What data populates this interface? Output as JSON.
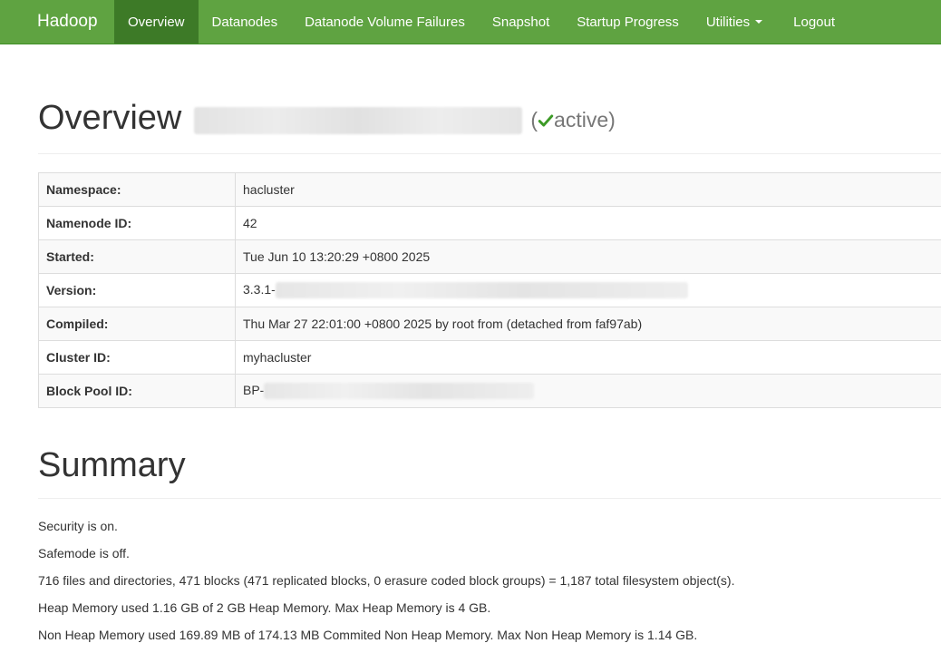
{
  "navbar": {
    "brand": "Hadoop",
    "items": [
      {
        "label": "Overview",
        "active": true
      },
      {
        "label": "Datanodes",
        "active": false
      },
      {
        "label": "Datanode Volume Failures",
        "active": false
      },
      {
        "label": "Snapshot",
        "active": false
      },
      {
        "label": "Startup Progress",
        "active": false
      },
      {
        "label": "Utilities",
        "active": false,
        "dropdown": true
      },
      {
        "label": "Logout",
        "active": false
      }
    ],
    "colors": {
      "background": "#5fa341",
      "active": "#3d7a27",
      "text": "#ffffff"
    }
  },
  "overview": {
    "title": "Overview",
    "status_open": "(",
    "status_icon": "check-icon",
    "status_text": "active)",
    "status_icon_color": "#3c9a26",
    "rows": [
      {
        "key": "Namespace:",
        "value": "hacluster"
      },
      {
        "key": "Namenode ID:",
        "value": "42"
      },
      {
        "key": "Started:",
        "value": "Tue Jun 10 13:20:29 +0800 2025"
      },
      {
        "key": "Version:",
        "value": "3.3.1-"
      },
      {
        "key": "Compiled:",
        "value": "Thu Mar 27 22:01:00 +0800 2025 by root from (detached from faf97ab)"
      },
      {
        "key": "Cluster ID:",
        "value": "myhacluster"
      },
      {
        "key": "Block Pool ID:",
        "value": "BP-"
      }
    ]
  },
  "summary": {
    "title": "Summary",
    "lines": [
      "Security is on.",
      "Safemode is off.",
      "716 files and directories, 471 blocks (471 replicated blocks, 0 erasure coded block groups) = 1,187 total filesystem object(s).",
      "Heap Memory used 1.16 GB of 2 GB Heap Memory. Max Heap Memory is 4 GB.",
      "Non Heap Memory used 169.89 MB of 174.13 MB Commited Non Heap Memory. Max Non Heap Memory is 1.14 GB."
    ]
  }
}
